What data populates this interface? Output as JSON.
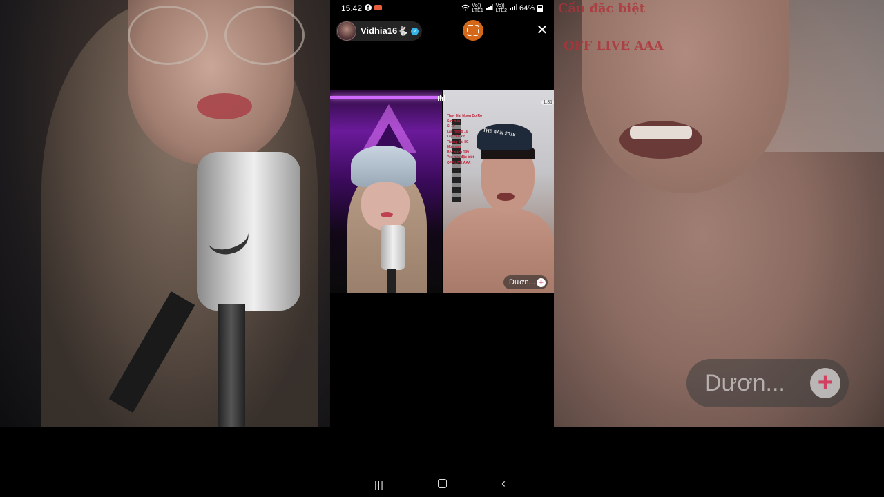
{
  "status_bar": {
    "time": "15.42",
    "facebook_glyph": "f",
    "sim1_label": "Vo))\nLTE1",
    "sim2_label": "Vo))\nLTE2",
    "battery": "64%"
  },
  "host": {
    "name": "Vidhia16",
    "emoji": "🐇",
    "verified": true
  },
  "controls": {
    "close_glyph": "✕"
  },
  "right_video": {
    "resolution_badge": "1.31",
    "cap_text": "THE 4AN 2018",
    "overlay_list": [
      "Thay Hai Ngon Do Ro",
      "Say hán",
      "Sỉ 10",
      "Lắc mông 10",
      "Lạy cầu xin",
      "Thùng đài 80",
      "Múa sạp",
      "Bốc sách 199",
      "Yes hỏa đặc biệt",
      "OFF LIVE AAA"
    ],
    "follow_label": "Dươn...",
    "follow_plus": "+"
  },
  "background": {
    "right_text_top": "Cầu đặc biệt",
    "right_text_mid": "OFF LIVE AAA",
    "follow_label_large": "Dươn...",
    "follow_plus_large": "+"
  },
  "nav_bar": {
    "recent_glyph": "|||",
    "back_glyph": "‹"
  },
  "colors": {
    "verified": "#37b4e8",
    "screenshot_button": "#d4681a",
    "follow_plus": "#d03050"
  }
}
